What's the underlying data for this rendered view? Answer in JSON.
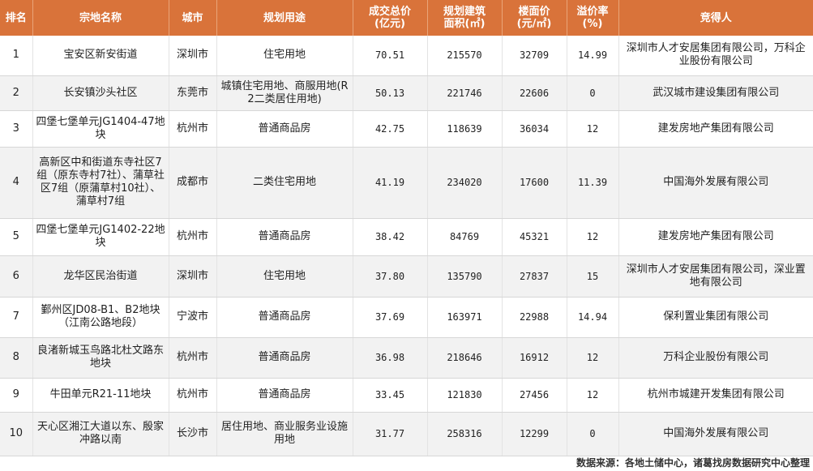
{
  "header": {
    "rank": "排名",
    "name": "宗地名称",
    "city": "城市",
    "use": "规划用途",
    "total_l1": "成交总价",
    "total_l2": "(亿元)",
    "area_l1": "规划建筑",
    "area_l2": "面积(㎡)",
    "floor_l1": "楼面价",
    "floor_l2": "(元/㎡)",
    "premium_l1": "溢价率",
    "premium_l2": "(%)",
    "winner": "竞得人"
  },
  "rows": [
    {
      "rank": "1",
      "name": "宝安区新安街道",
      "city": "深圳市",
      "use": "住宅用地",
      "total": "70.51",
      "area": "215570",
      "floor": "32709",
      "premium": "14.99",
      "winner": "深圳市人才安居集团有限公司，万科企业股份有限公司"
    },
    {
      "rank": "2",
      "name": "长安镇沙头社区",
      "city": "东莞市",
      "use": "城镇住宅用地、商服用地(R2二类居住用地)",
      "total": "50.13",
      "area": "221746",
      "floor": "22606",
      "premium": "0",
      "winner": "武汉城市建设集团有限公司"
    },
    {
      "rank": "3",
      "name": "四堡七堡单元JG1404-47地块",
      "city": "杭州市",
      "use": "普通商品房",
      "total": "42.75",
      "area": "118639",
      "floor": "36034",
      "premium": "12",
      "winner": "建发房地产集团有限公司"
    },
    {
      "rank": "4",
      "name": "高新区中和街道东寺社区7组（原东寺村7社）、蒲草社区7组（原蒲草村10社）、蒲草村7组",
      "city": "成都市",
      "use": "二类住宅用地",
      "total": "41.19",
      "area": "234020",
      "floor": "17600",
      "premium": "11.39",
      "winner": "中国海外发展有限公司"
    },
    {
      "rank": "5",
      "name": "四堡七堡单元JG1402-22地块",
      "city": "杭州市",
      "use": "普通商品房",
      "total": "38.42",
      "area": "84769",
      "floor": "45321",
      "premium": "12",
      "winner": "建发房地产集团有限公司"
    },
    {
      "rank": "6",
      "name": "龙华区民治街道",
      "city": "深圳市",
      "use": "住宅用地",
      "total": "37.80",
      "area": "135790",
      "floor": "27837",
      "premium": "15",
      "winner": "深圳市人才安居集团有限公司，深业置地有限公司"
    },
    {
      "rank": "7",
      "name": "鄞州区JD08-B1、B2地块（江南公路地段）",
      "city": "宁波市",
      "use": "普通商品房",
      "total": "37.69",
      "area": "163971",
      "floor": "22988",
      "premium": "14.94",
      "winner": "保利置业集团有限公司"
    },
    {
      "rank": "8",
      "name": "良渚新城玉鸟路北杜文路东地块",
      "city": "杭州市",
      "use": "普通商品房",
      "total": "36.98",
      "area": "218646",
      "floor": "16912",
      "premium": "12",
      "winner": "万科企业股份有限公司"
    },
    {
      "rank": "9",
      "name": "牛田单元R21-11地块",
      "city": "杭州市",
      "use": "普通商品房",
      "total": "33.45",
      "area": "121830",
      "floor": "27456",
      "premium": "12",
      "winner": "杭州市城建开发集团有限公司"
    },
    {
      "rank": "10",
      "name": "天心区湘江大道以东、殷家冲路以南",
      "city": "长沙市",
      "use": "居住用地、商业服务业设施用地",
      "total": "31.77",
      "area": "258316",
      "floor": "12299",
      "premium": "0",
      "winner": "中国海外发展有限公司"
    }
  ],
  "source": "数据来源：各地土储中心，诸葛找房数据研究中心整理"
}
